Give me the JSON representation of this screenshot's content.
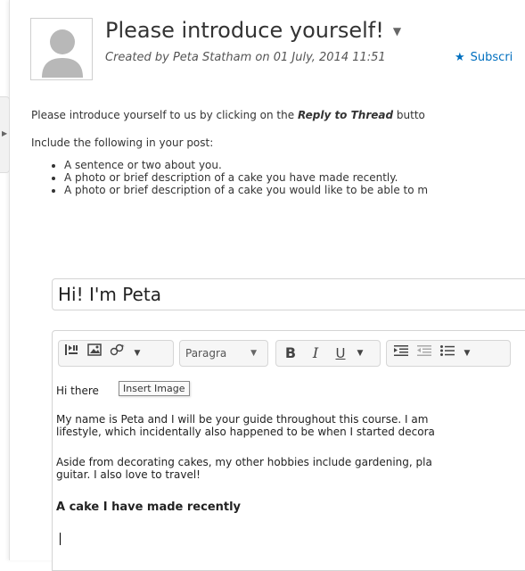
{
  "thread": {
    "title": "Please introduce yourself!",
    "meta": "Created by Peta Statham on 01 July, 2014 11:51",
    "subscribe_label": "Subscri"
  },
  "body": {
    "intro_prefix": "Please introduce yourself to us by clicking on the ",
    "intro_bold": "Reply to Thread",
    "intro_suffix": " butto",
    "include_line": "Include the following in your post:",
    "requirements": [
      "A sentence or two about you.",
      "A photo or brief description of a cake you have made recently.",
      "A photo or brief description of a cake you would like to be able to m"
    ]
  },
  "reply": {
    "subject_value": "Hi! I'm Peta",
    "toolbar": {
      "paragraph_label": "Paragra",
      "bold_label": "B",
      "italic_label": "I",
      "underline_label": "U"
    },
    "tooltip": "Insert Image",
    "content": {
      "greeting": "Hi there",
      "para1_line1": "My name is Peta and I will be your guide throughout this course. I am",
      "para1_line2": "lifestyle, which incidentally also happened to be when I started decora",
      "para2_line1": "Aside from decorating cakes, my other hobbies include gardening, pla",
      "para2_line2": "guitar. I also love to travel!",
      "heading": "A cake I have made recently"
    }
  }
}
